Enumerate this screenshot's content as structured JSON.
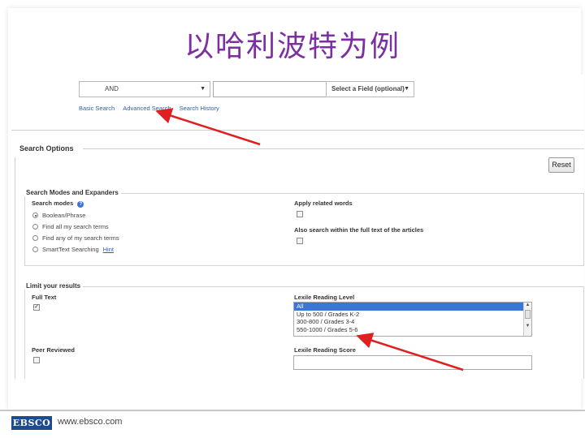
{
  "slide": {
    "title": "以哈利波特为例",
    "footer_logo": "EBSCO",
    "footer_url": "www.ebsco.com"
  },
  "search_bar": {
    "boolean_select": "AND",
    "search_input": "",
    "field_select": "Select a Field (optional)",
    "links": [
      "Basic Search",
      "Advanced Search",
      "Search History"
    ]
  },
  "search_options": {
    "title": "Search Options",
    "reset_label": "Reset",
    "modes": {
      "title": "Search Modes and Expanders",
      "search_modes_label": "Search modes",
      "help_icon": "?",
      "options": [
        "Boolean/Phrase",
        "Find all my search terms",
        "Find any of my search terms",
        "SmartText Searching"
      ],
      "selected": "Boolean/Phrase",
      "hint_link": "Hint",
      "apply_related_label": "Apply related words",
      "also_search_label": "Also search within the full text of the articles"
    },
    "limits": {
      "title": "Limit your results",
      "full_text_label": "Full Text",
      "peer_reviewed_label": "Peer Reviewed",
      "lexile_level_label": "Lexile Reading Level",
      "lexile_options": [
        "All",
        "Up to 500 / Grades K-2",
        "300-800 / Grades 3-4",
        "550-1000 / Grades 5-6"
      ],
      "lexile_selected": "All",
      "lexile_score_label": "Lexile Reading Score",
      "lexile_score_value": ""
    }
  },
  "colors": {
    "title": "#7b2fa0",
    "link": "#3060a8",
    "arrow": "#e02020",
    "selected_option": "#3a76d8",
    "logo_bg": "#1e4b8f"
  }
}
